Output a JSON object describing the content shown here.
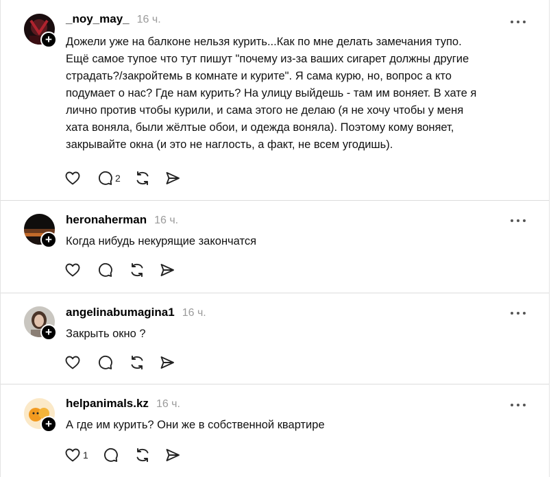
{
  "posts": [
    {
      "username": "_noy_may_",
      "time": "16 ч.",
      "text": "Дожели уже на балконе нельзя курить...Как по мне делать замечания тупо.\nЕщё самое тупое что тут пишут \"почему из-за ваших сигарет должны другие\nстрадать?/закройтемь в комнате и курите\". Я сама курю, но, вопрос а кто\nподумает о нас? Где нам курить? На улицу выйдешь - там им воняет. В хате я\nлично против чтобы курили, и сама этого не делаю (я не хочу чтобы у меня\nхата воняла, были жёлтые обои, и одежда воняла). Поэтому кому воняет,\nзакрывайте окна (и это не наглость, а факт, не всем угодишь).",
      "likes": "",
      "replies": "2"
    },
    {
      "username": "heronaherman",
      "time": "16 ч.",
      "text": "Когда нибудь некурящие закончатся",
      "likes": "",
      "replies": ""
    },
    {
      "username": "angelinabumagina1",
      "time": "16 ч.",
      "text": "Закрыть окно ?",
      "likes": "",
      "replies": ""
    },
    {
      "username": "helpanimals.kz",
      "time": "16 ч.",
      "text": "А где им курить? Они же в собственной квартире",
      "likes": "1",
      "replies": ""
    }
  ],
  "icons": {
    "like": "heart-icon",
    "reply": "comment-icon",
    "repost": "repost-icon",
    "share": "send-icon",
    "more": "more-icon",
    "follow": "plus-icon"
  },
  "badge_symbol": "+"
}
